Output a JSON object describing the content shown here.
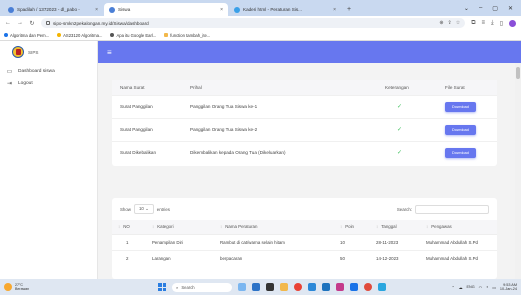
{
  "browser": {
    "tabs": [
      {
        "label": "Spadilah / 1372023 - dl_pabo - ",
        "active": false
      },
      {
        "label": "Siswa",
        "active": true
      },
      {
        "label": "Kaderi html - Peraturan Sis... ",
        "active": false
      }
    ],
    "new_tab": "+",
    "url": "sipo-smkn2pekalongan.my.id/Siswa/dashboard",
    "bookmarks": [
      "Algoritma dan Pem...",
      "AS23120 Algoritma...",
      "Apa itu Google Earl...",
      "function tambah_ite..."
    ]
  },
  "sidebar": {
    "brand": "SIPS",
    "items": [
      {
        "label": "Dashboard siswa",
        "icon": "monitor-icon"
      },
      {
        "label": "Logout",
        "icon": "logout-icon"
      }
    ]
  },
  "surat_table": {
    "headers": [
      "Nama Surat",
      "Prihal",
      "Keterangan",
      "File Surat"
    ],
    "rows": [
      {
        "nama": "Surat Panggilan",
        "prihal": "Panggilan Orang Tua Siswa ke-1",
        "download": "Download"
      },
      {
        "nama": "Surat Panggilan",
        "prihal": "Panggilan Orang Tua Siswa ke-2",
        "download": "Download"
      },
      {
        "nama": "Surat Dikebalikan",
        "prihal": "Dikembalikan kepada Orang Tua (Dikeluarkan)",
        "download": "Download"
      }
    ],
    "check_symbol": "✓"
  },
  "peraturan_table": {
    "show_label": "Show",
    "show_value": "10",
    "entries_label": "entries",
    "search_label": "Search:",
    "headers": [
      "NO",
      "Kategori",
      "Nama Peraturan",
      "Poin",
      "Tanggal",
      "Pengawas"
    ],
    "rows": [
      {
        "no": "1",
        "kategori": "Penampilan Diri",
        "nama": "Rambut di cat/warna selain hitam",
        "poin": "10",
        "tanggal": "28-11-2023",
        "pengawas": "Muhammad Abdullah S.Pd"
      },
      {
        "no": "2",
        "kategori": "Larangan",
        "nama": "berpacaran",
        "poin": "50",
        "tanggal": "14-12-2023",
        "pengawas": "Muhammad Abdullah S.Pd"
      }
    ]
  },
  "taskbar": {
    "weather_line1": "27°C",
    "weather_line2": "Berawan",
    "search_placeholder": "Search",
    "lang": "ENG",
    "time": "9:53 AM",
    "date": "10-Jan-24"
  },
  "colors": {
    "accent": "#6777ef",
    "success": "#47c363"
  }
}
